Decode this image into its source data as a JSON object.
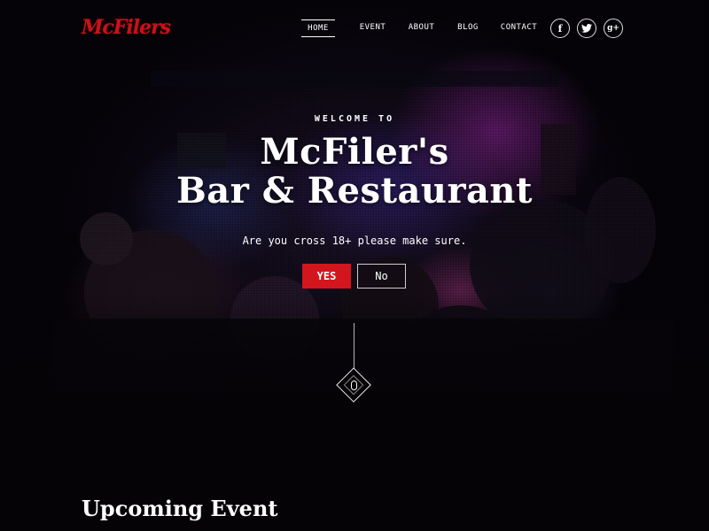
{
  "brand": {
    "logo_text": "McFilers",
    "accent_color": "#d3151d"
  },
  "nav": {
    "items": [
      {
        "label": "HOME",
        "active": true
      },
      {
        "label": "EVENT",
        "active": false
      },
      {
        "label": "ABOUT",
        "active": false
      },
      {
        "label": "BLOG",
        "active": false
      },
      {
        "label": "CONTACT",
        "active": false
      }
    ]
  },
  "social": [
    {
      "icon": "facebook-icon",
      "glyph": "f"
    },
    {
      "icon": "twitter-icon",
      "glyph": "t"
    },
    {
      "icon": "google-plus-icon",
      "glyph": "g+"
    }
  ],
  "hero": {
    "welcome": "WELCOME TO",
    "title_line1": "McFiler's",
    "title_line2": "Bar & Restaurant",
    "subtitle": "Are you cross 18+ please make sure.",
    "yes_label": "YES",
    "no_label": "No",
    "scroll_icon": "mouse-scroll-icon"
  },
  "sections": {
    "upcoming_title": "Upcoming Event"
  }
}
